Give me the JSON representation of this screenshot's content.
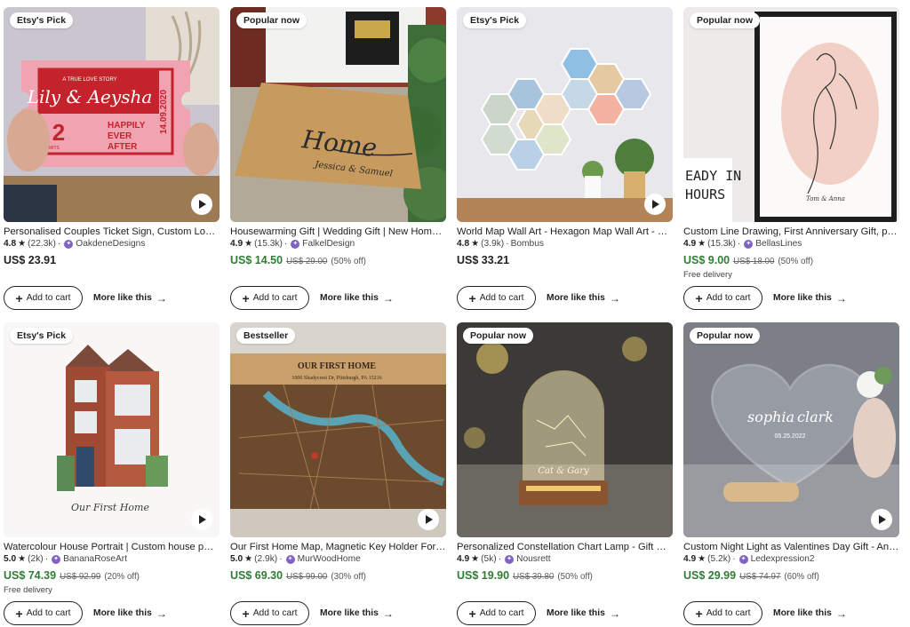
{
  "products": [
    {
      "badge": "Etsy's Pick",
      "title": "Personalised Couples Ticket Sign, Custom Lov…",
      "score": "4.8",
      "reviews": "(22.3k)",
      "shop": "OakdeneDesigns",
      "price": "US$ 23.91",
      "orig": "",
      "off": "",
      "free": "",
      "video": true
    },
    {
      "badge": "Popular now",
      "title": "Housewarming Gift | Wedding Gift | New Hom…",
      "score": "4.9",
      "reviews": "(15.3k)",
      "shop": "FalkelDesign",
      "price": "US$ 14.50",
      "orig": "US$ 29.00",
      "off": "(50% off)",
      "free": "",
      "video": false
    },
    {
      "badge": "Etsy's Pick",
      "title": "World Map Wall Art - Hexagon Map Wall Art - P…",
      "score": "4.8",
      "reviews": "(3.9k)",
      "shop": "Bombus",
      "price": "US$ 33.21",
      "orig": "",
      "off": "",
      "free": "",
      "video": true
    },
    {
      "badge": "Popular now",
      "title": "Custom Line Drawing, First Anniversary Gift, p…",
      "score": "4.9",
      "reviews": "(15.3k)",
      "shop": "BellasLines",
      "price": "US$ 9.00",
      "orig": "US$ 18.00",
      "off": "(50% off)",
      "free": "Free delivery",
      "video": false
    },
    {
      "badge": "Etsy's Pick",
      "title": "Watercolour House Portrait | Custom house p…",
      "score": "5.0",
      "reviews": "(2k)",
      "shop": "BananaRoseArt",
      "price": "US$ 74.39",
      "orig": "US$ 92.99",
      "off": "(20% off)",
      "free": "Free delivery",
      "video": true
    },
    {
      "badge": "Bestseller",
      "title": "Our First Home Map, Magnetic Key Holder For…",
      "score": "5.0",
      "reviews": "(2.9k)",
      "shop": "MurWoodHome",
      "price": "US$ 69.30",
      "orig": "US$ 99.00",
      "off": "(30% off)",
      "free": "",
      "video": true
    },
    {
      "badge": "Popular now",
      "title": "Personalized Constellation Chart Lamp - Gift S…",
      "score": "4.9",
      "reviews": "(5k)",
      "shop": "Nousrett",
      "price": "US$ 19.90",
      "orig": "US$ 39.80",
      "off": "(50% off)",
      "free": "",
      "video": false
    },
    {
      "badge": "Popular now",
      "title": "Custom Night Light as Valentines Day Gift - An…",
      "score": "4.9",
      "reviews": "(5.2k)",
      "shop": "Ledexpression2",
      "price": "US$ 29.99",
      "orig": "US$ 74.97",
      "off": "(60% off)",
      "free": "",
      "video": true
    }
  ],
  "art_text": {
    "ticket_top": "A TRUE LOVE STORY",
    "ticket_names": "Lily & Aeysha",
    "ticket_num": "2",
    "ticket_admits": "ADMITS",
    "ticket_slogan_1": "HAPPILY",
    "ticket_slogan_2": "EVER",
    "ticket_slogan_3": "AFTER",
    "ticket_date": "14.09.2020",
    "mat_word": "Home",
    "mat_names": "Jessica & Samuel",
    "poster_1": "EADY IN",
    "poster_2": "HOURS",
    "line_names": "Tom & Anna",
    "house_caption": "Our First Home",
    "map_title": "OUR FIRST HOME",
    "map_address": "1006 Shadycrest Dr, Pittsburgh, PA 15216",
    "lamp_names": "Cat & Gary",
    "light_name_1": "sophia",
    "light_name_2": "clark",
    "light_date": "05.25.2022"
  },
  "labels": {
    "add_to_cart": "Add to cart",
    "more_like_this": "More like this"
  },
  "colors": {
    "sale_price": "#2f7d35",
    "shop_badge": "#7f62c4"
  }
}
